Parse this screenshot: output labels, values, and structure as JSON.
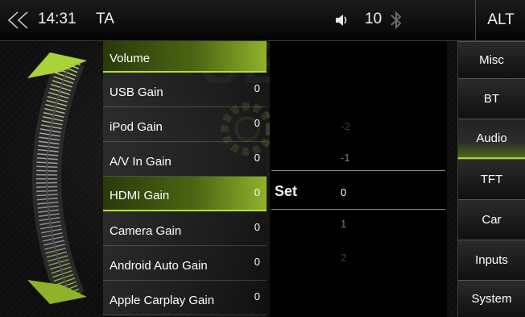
{
  "status_bar": {
    "time": "14:31",
    "source": "TA",
    "volume": "10",
    "alt_label": "ALT"
  },
  "settings": [
    {
      "label": "Volume",
      "value": ""
    },
    {
      "label": "USB Gain",
      "value": "0"
    },
    {
      "label": "iPod Gain",
      "value": "0"
    },
    {
      "label": "A/V In Gain",
      "value": "0"
    },
    {
      "label": "HDMI Gain",
      "value": "0"
    },
    {
      "label": "Camera Gain",
      "value": "0"
    },
    {
      "label": "Android Auto Gain",
      "value": "0"
    },
    {
      "label": "Apple Carplay Gain",
      "value": "0"
    }
  ],
  "picker": {
    "set_label": "Set",
    "values": [
      "-2",
      "-1",
      "0",
      "1",
      "2"
    ],
    "selected": "0"
  },
  "nav": [
    {
      "label": "Misc"
    },
    {
      "label": "BT"
    },
    {
      "label": "Audio"
    },
    {
      "label": "TFT"
    },
    {
      "label": "Car"
    },
    {
      "label": "Inputs"
    },
    {
      "label": "System"
    }
  ],
  "colors": {
    "accent": "#9ccc2c",
    "background": "#0a0a0a"
  }
}
